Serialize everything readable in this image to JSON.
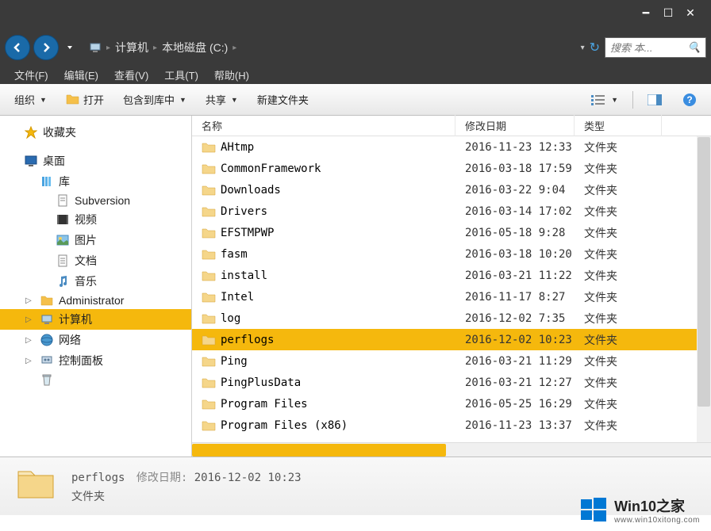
{
  "titlebar": {
    "min": "━",
    "max": "☐",
    "close": "✕"
  },
  "breadcrumb": {
    "computer": "计算机",
    "drive": "本地磁盘 (C:)"
  },
  "search": {
    "placeholder": "搜索 本..."
  },
  "menu": {
    "file": "文件(F)",
    "edit": "编辑(E)",
    "view": "查看(V)",
    "tools": "工具(T)",
    "help": "帮助(H)"
  },
  "toolbar": {
    "organize": "组织",
    "open": "打开",
    "include": "包含到库中",
    "share": "共享",
    "newfolder": "新建文件夹"
  },
  "tree": {
    "favorites": "收藏夹",
    "desktop": "桌面",
    "libraries": "库",
    "subversion": "Subversion",
    "videos": "视频",
    "pictures": "图片",
    "documents": "文档",
    "music": "音乐",
    "admin": "Administrator",
    "computer": "计算机",
    "network": "网络",
    "controlpanel": "控制面板",
    "recyclebin": ""
  },
  "columns": {
    "name": "名称",
    "date": "修改日期",
    "type": "类型"
  },
  "files": [
    {
      "name": "AHtmp",
      "date": "2016-11-23 12:33",
      "type": "文件夹",
      "selected": false
    },
    {
      "name": "CommonFramework",
      "date": "2016-03-18 17:59",
      "type": "文件夹",
      "selected": false
    },
    {
      "name": "Downloads",
      "date": "2016-03-22 9:04",
      "type": "文件夹",
      "selected": false
    },
    {
      "name": "Drivers",
      "date": "2016-03-14 17:02",
      "type": "文件夹",
      "selected": false
    },
    {
      "name": "EFSTMPWP",
      "date": "2016-05-18 9:28",
      "type": "文件夹",
      "selected": false
    },
    {
      "name": "fasm",
      "date": "2016-03-18 10:20",
      "type": "文件夹",
      "selected": false
    },
    {
      "name": "install",
      "date": "2016-03-21 11:22",
      "type": "文件夹",
      "selected": false
    },
    {
      "name": "Intel",
      "date": "2016-11-17 8:27",
      "type": "文件夹",
      "selected": false
    },
    {
      "name": "log",
      "date": "2016-12-02 7:35",
      "type": "文件夹",
      "selected": false
    },
    {
      "name": "perflogs",
      "date": "2016-12-02 10:23",
      "type": "文件夹",
      "selected": true
    },
    {
      "name": "Ping",
      "date": "2016-03-21 11:29",
      "type": "文件夹",
      "selected": false
    },
    {
      "name": "PingPlusData",
      "date": "2016-03-21 12:27",
      "type": "文件夹",
      "selected": false
    },
    {
      "name": "Program Files",
      "date": "2016-05-25 16:29",
      "type": "文件夹",
      "selected": false
    },
    {
      "name": "Program Files (x86)",
      "date": "2016-11-23 13:37",
      "type": "文件夹",
      "selected": false
    }
  ],
  "details": {
    "name": "perflogs",
    "date_label": "修改日期:",
    "date": "2016-12-02 10:23",
    "type": "文件夹"
  },
  "watermark": {
    "title": "Win10之家",
    "sub": "www.win10xitong.com"
  }
}
